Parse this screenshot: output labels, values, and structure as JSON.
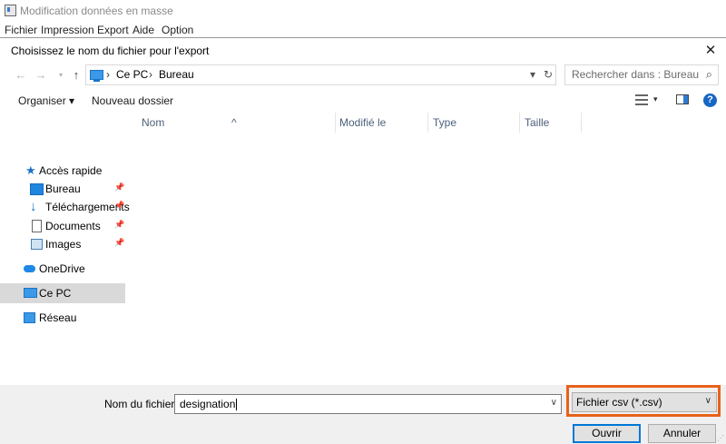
{
  "app": {
    "title": "Modification données en masse",
    "menu": [
      "Fichier",
      "Impression",
      "Export",
      "Aide",
      "Option"
    ]
  },
  "dialog": {
    "title": "Choisissez le nom du fichier pour l'export",
    "close_icon": "close-icon",
    "breadcrumb": [
      "Ce PC",
      "Bureau"
    ],
    "search_placeholder": "Rechercher dans : Bureau",
    "toolbar": {
      "organize": "Organiser ▾",
      "new_folder": "Nouveau dossier"
    },
    "sidebar": {
      "quick_access": "Accès rapide",
      "items": [
        {
          "label": "Bureau",
          "icon": "desktop-icon",
          "pinned": true
        },
        {
          "label": "Téléchargements",
          "icon": "download-icon",
          "pinned": true
        },
        {
          "label": "Documents",
          "icon": "document-icon",
          "pinned": true
        },
        {
          "label": "Images",
          "icon": "images-icon",
          "pinned": true
        }
      ],
      "onedrive": "OneDrive",
      "this_pc": "Ce PC",
      "network": "Réseau"
    },
    "columns": [
      "Nom",
      "Modifié le",
      "Type",
      "Taille"
    ],
    "footer": {
      "filename_label": "Nom du fichier :",
      "filename_value": "designation",
      "filetype_value": "Fichier csv (*.csv)",
      "open_label": "Ouvrir",
      "cancel_label": "Annuler"
    },
    "colors": {
      "accent": "#0078d7",
      "highlight": "#e8611a",
      "selection": "#d9d9d9"
    }
  }
}
